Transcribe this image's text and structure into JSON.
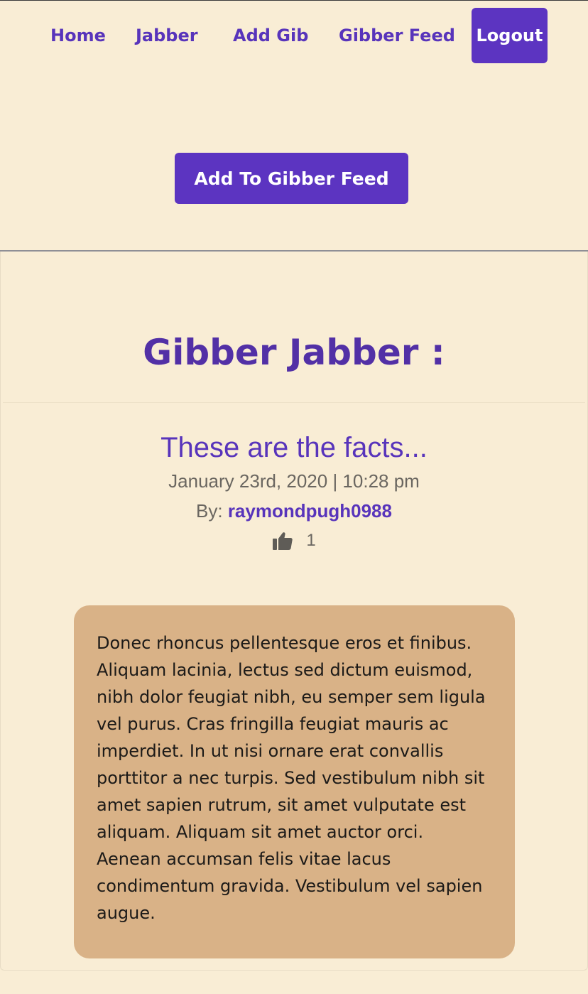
{
  "nav": {
    "home": "Home",
    "jabber": "Jabber",
    "add_gib": "Add Gib",
    "gibber_feed": "Gibber Feed",
    "logout": "Logout"
  },
  "actions": {
    "add_to_feed": "Add To Gibber Feed"
  },
  "page": {
    "title": "Gibber Jabber :"
  },
  "post": {
    "title": "These are the facts...",
    "timestamp": "January 23rd, 2020 | 10:28 pm",
    "by_label": "By:",
    "author": "raymondpugh0988",
    "like_icon": "thumbs-up-icon",
    "likes": "1",
    "body": "Donec rhoncus pellentesque eros et finibus. Aliquam lacinia, lectus sed dictum euismod, nibh dolor feugiat nibh, eu semper sem ligula vel purus. Cras fringilla feugiat mauris ac imperdiet. In ut nisi ornare erat convallis porttitor a nec turpis. Sed vestibulum nibh sit amet sapien rutrum, sit amet vulputate est aliquam. Aliquam sit amet auctor orci. Aenean accumsan felis vitae lacus condimentum gravida. Vestibulum vel sapien augue."
  },
  "colors": {
    "background": "#f9edd5",
    "accent": "#5c34c1",
    "heading": "#5230a6",
    "post_body_bg": "#d9b287"
  }
}
